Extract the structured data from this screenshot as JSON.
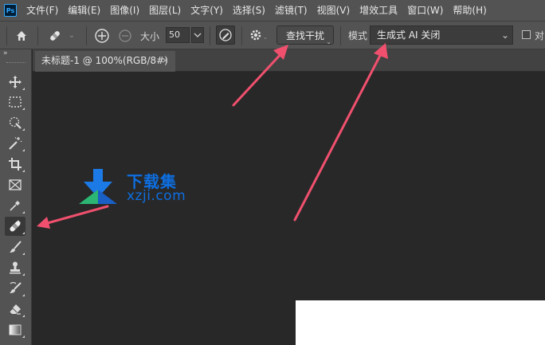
{
  "menubar": {
    "logo": "Ps",
    "items": [
      "文件(F)",
      "编辑(E)",
      "图像(I)",
      "图层(L)",
      "文字(Y)",
      "选择(S)",
      "滤镜(T)",
      "视图(V)",
      "增效工具",
      "窗口(W)",
      "帮助(H)"
    ]
  },
  "options": {
    "size_label": "大小",
    "size_value": "50",
    "find_button": "查找干扰",
    "mode_label": "模式",
    "mode_value": "生成式 AI 关闭",
    "checkbox_label": "对"
  },
  "tools": {
    "collapse": "»",
    "items": [
      "move-icon",
      "marquee-icon",
      "quick-select-icon",
      "magic-wand-icon",
      "crop-icon",
      "frame-icon",
      "eyedropper-icon",
      "healing-brush-icon",
      "brush-icon",
      "clone-stamp-icon",
      "history-brush-icon",
      "eraser-icon",
      "gradient-icon"
    ],
    "active_tool": "healing-brush-icon"
  },
  "document_tab": {
    "title": "未标题-1 @ 100%(RGB/8#)",
    "close": "×"
  },
  "watermark": {
    "title": "下载集",
    "domain": "xzji.com"
  },
  "colors": {
    "panel": "#535353",
    "canvas": "#282828",
    "annotation": "#f0506e",
    "watermark_blue": "#0e6ee0",
    "watermark_green": "#2bb673"
  }
}
